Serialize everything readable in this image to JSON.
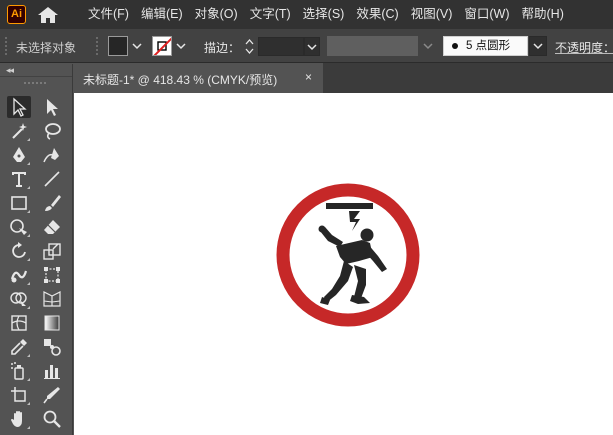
{
  "app": {
    "logo_text": "Ai"
  },
  "menu": {
    "items": [
      "文件(F)",
      "编辑(E)",
      "对象(O)",
      "文字(T)",
      "选择(S)",
      "效果(C)",
      "视图(V)",
      "窗口(W)",
      "帮助(H)"
    ]
  },
  "control_bar": {
    "selection_status": "未选择对象",
    "fill_color": "#262626",
    "stroke_label": "描边：",
    "stroke_weight_value": "",
    "brush_profile": "5 点圆形",
    "opacity_label": "不透明度："
  },
  "document_tab": {
    "title": "未标题-1* @ 418.43 % (CMYK/预览)",
    "close_glyph": "×"
  },
  "toolbar": {
    "collapse_glyph": "◂◂",
    "tools": [
      "selection-tool",
      "direct-selection-tool",
      "magic-wand-tool",
      "lasso-tool",
      "pen-tool",
      "curvature-tool",
      "type-tool",
      "line-segment-tool",
      "rectangle-tool",
      "paintbrush-tool",
      "shaper-tool",
      "eraser-tool",
      "rotate-tool",
      "scale-tool",
      "warp-tool",
      "free-transform-tool",
      "shape-builder-tool",
      "perspective-grid-tool",
      "mesh-tool",
      "gradient-tool",
      "eyedropper-tool",
      "blend-tool",
      "symbol-sprayer-tool",
      "column-graph-tool",
      "artboard-tool",
      "slice-tool",
      "hand-tool",
      "zoom-tool"
    ]
  },
  "artwork": {
    "ring_color": "#c62828",
    "figure_color": "#262626"
  }
}
